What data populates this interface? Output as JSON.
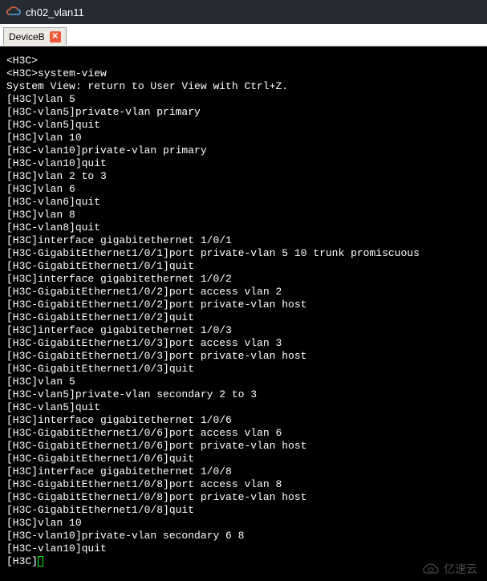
{
  "window": {
    "title": "ch02_vlan11"
  },
  "tab": {
    "label": "DeviceB"
  },
  "terminal": {
    "lines": [
      "<H3C>",
      "<H3C>system-view",
      "System View: return to User View with Ctrl+Z.",
      "[H3C]vlan 5",
      "[H3C-vlan5]private-vlan primary",
      "[H3C-vlan5]quit",
      "[H3C]vlan 10",
      "[H3C-vlan10]private-vlan primary",
      "[H3C-vlan10]quit",
      "[H3C]vlan 2 to 3",
      "[H3C]vlan 6",
      "[H3C-vlan6]quit",
      "[H3C]vlan 8",
      "[H3C-vlan8]quit",
      "[H3C]interface gigabitethernet 1/0/1",
      "[H3C-GigabitEthernet1/0/1]port private-vlan 5 10 trunk promiscuous",
      "[H3C-GigabitEthernet1/0/1]quit",
      "[H3C]interface gigabitethernet 1/0/2",
      "[H3C-GigabitEthernet1/0/2]port access vlan 2",
      "[H3C-GigabitEthernet1/0/2]port private-vlan host",
      "[H3C-GigabitEthernet1/0/2]quit",
      "[H3C]interface gigabitethernet 1/0/3",
      "[H3C-GigabitEthernet1/0/3]port access vlan 3",
      "[H3C-GigabitEthernet1/0/3]port private-vlan host",
      "[H3C-GigabitEthernet1/0/3]quit",
      "[H3C]vlan 5",
      "[H3C-vlan5]private-vlan secondary 2 to 3",
      "[H3C-vlan5]quit",
      "[H3C]interface gigabitethernet 1/0/6",
      "[H3C-GigabitEthernet1/0/6]port access vlan 6",
      "[H3C-GigabitEthernet1/0/6]port private-vlan host",
      "[H3C-GigabitEthernet1/0/6]quit",
      "[H3C]interface gigabitethernet 1/0/8",
      "[H3C-GigabitEthernet1/0/8]port access vlan 8",
      "[H3C-GigabitEthernet1/0/8]port private-vlan host",
      "[H3C-GigabitEthernet1/0/8]quit",
      "[H3C]vlan 10",
      "[H3C-vlan10]private-vlan secondary 6 8",
      "[H3C-vlan10]quit"
    ],
    "prompt": "[H3C]"
  },
  "watermark": {
    "text": "亿速云"
  }
}
